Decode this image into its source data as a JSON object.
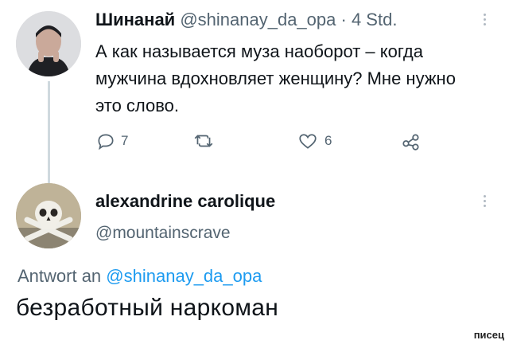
{
  "tweet1": {
    "author_name": "Шинанай",
    "handle": "@shinanay_da_opa",
    "separator": "·",
    "time": "4 Std.",
    "text": "А как называется муза наоборот – когда мужчина вдохновляет женщину? Мне нужно это слово.",
    "actions": {
      "reply_count": "7",
      "like_count": "6"
    }
  },
  "tweet2": {
    "author_name": "alexandrine carolique",
    "handle": "@mountainscrave",
    "reply_prefix": "Antwort an",
    "reply_mention": "@shinanay_da_opa",
    "text": "безработный наркоман"
  },
  "watermark": "писец",
  "colors": {
    "text": "#0f1419",
    "secondary": "#536471",
    "link": "#1d9bf0",
    "thread_line": "#cfd9de"
  }
}
